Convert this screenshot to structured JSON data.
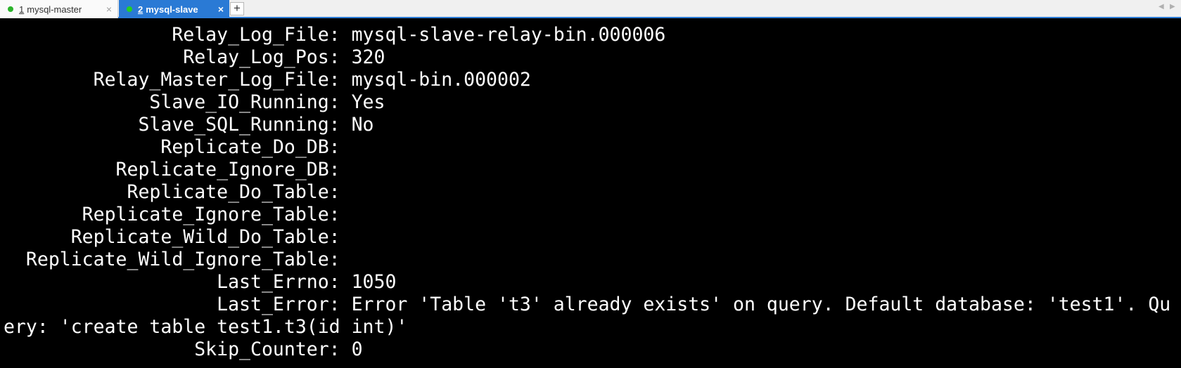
{
  "tabs": [
    {
      "number": "1",
      "title": "mysql-master",
      "active": false,
      "status_color": "#2bb32b",
      "close": "×"
    },
    {
      "number": "2",
      "title": "mysql-slave",
      "active": true,
      "status_color": "#23d023",
      "close": "×"
    }
  ],
  "add_tab_label": "+",
  "nav": {
    "left_arrow": "◀",
    "right_arrow": "▶"
  },
  "terminal": {
    "lines": [
      "               Relay_Log_File: mysql-slave-relay-bin.000006",
      "                Relay_Log_Pos: 320",
      "        Relay_Master_Log_File: mysql-bin.000002",
      "             Slave_IO_Running: Yes",
      "            Slave_SQL_Running: No",
      "              Replicate_Do_DB:",
      "          Replicate_Ignore_DB:",
      "           Replicate_Do_Table:",
      "       Replicate_Ignore_Table:",
      "      Replicate_Wild_Do_Table:",
      "  Replicate_Wild_Ignore_Table:",
      "                   Last_Errno: 1050",
      "                   Last_Error: Error 'Table 't3' already exists' on query. Default database: 'test1'. Qu",
      "ery: 'create table test1.t3(id int)'",
      "                 Skip_Counter: 0"
    ]
  }
}
